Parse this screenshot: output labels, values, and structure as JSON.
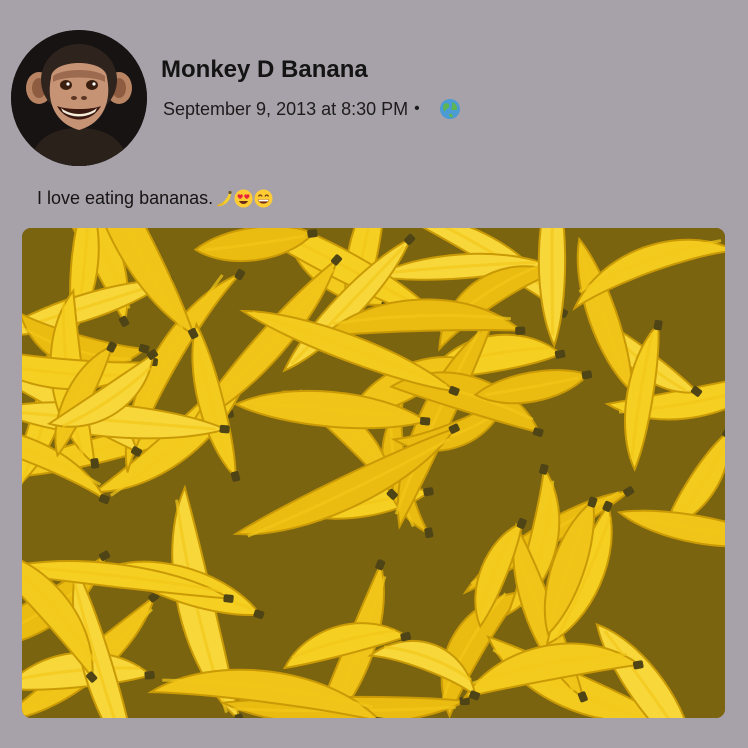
{
  "post": {
    "author_name": "Monkey D Banana",
    "timestamp": "September 9, 2013 at 8:30 PM",
    "separator": "•",
    "audience_icon": "globe-icon",
    "caption_text": "I love eating bananas.",
    "caption_emojis": [
      "banana-emoji",
      "heart-eyes-emoji",
      "grinning-face-emoji"
    ],
    "avatar": "chimpanzee-avatar",
    "photo": "pile-of-bananas-photo"
  },
  "colors": {
    "background": "#a7a1a9",
    "banana_yellow": "#f2c81a",
    "banana_shadow": "#c99a06",
    "stem_dark": "#4e4416"
  }
}
